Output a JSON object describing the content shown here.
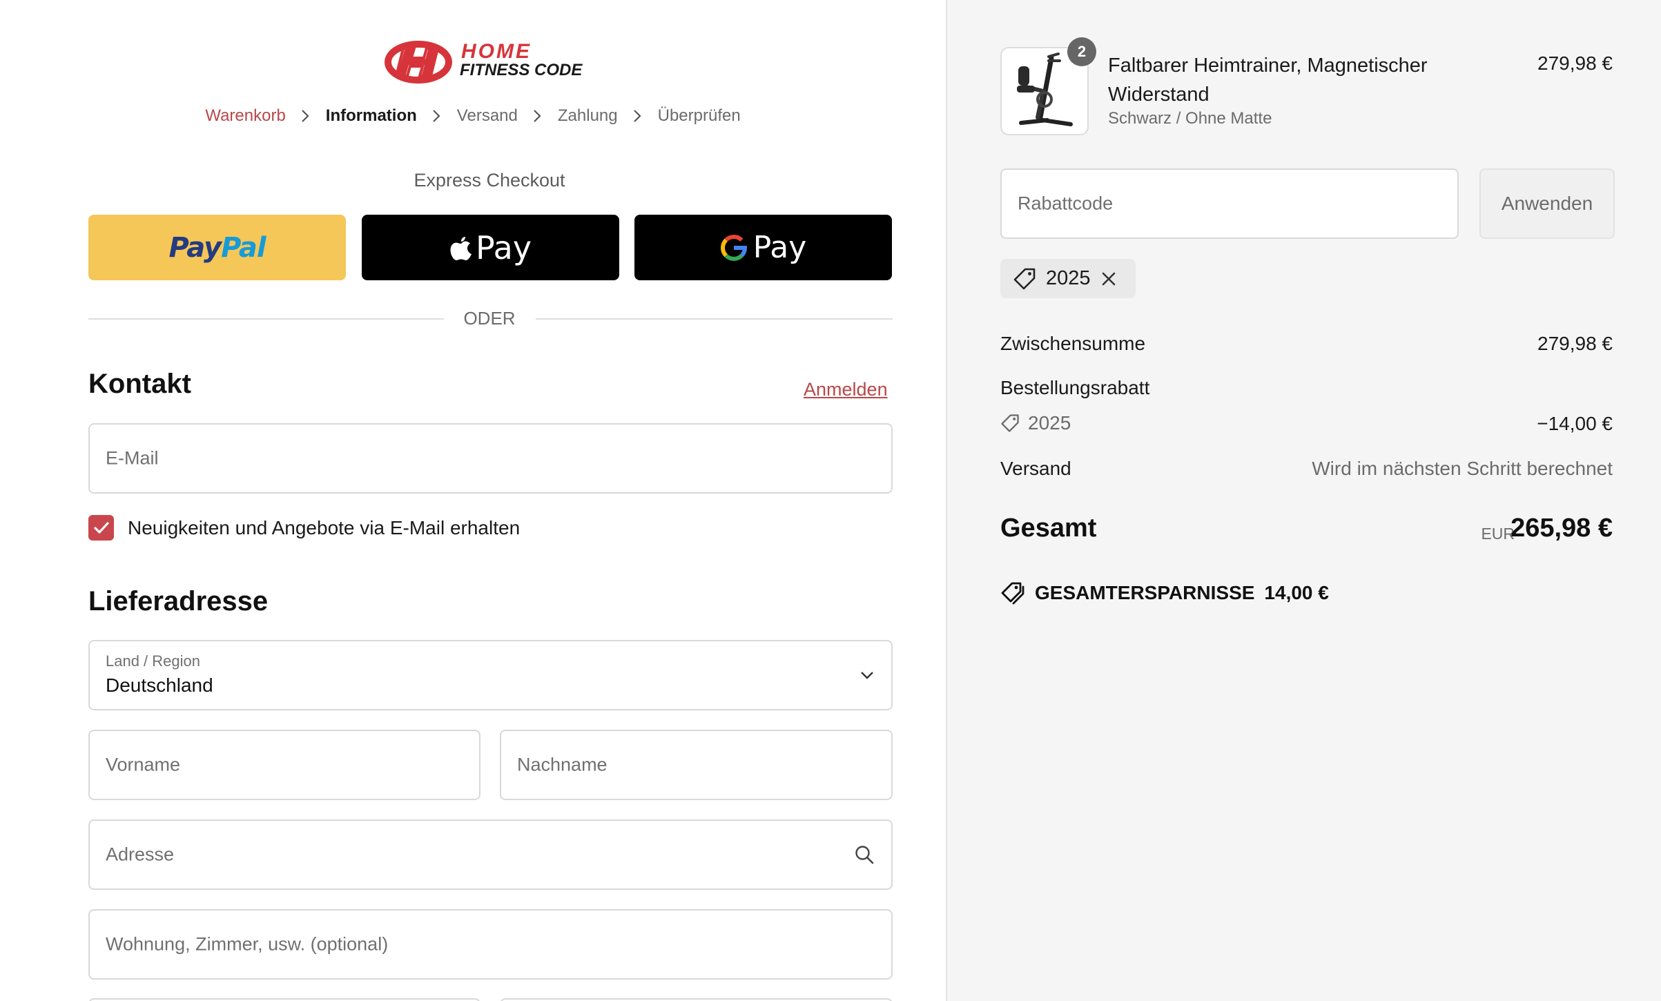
{
  "brand": {
    "line1": "HOME",
    "line2": "FITNESS CODE"
  },
  "breadcrumb": [
    {
      "label": "Warenkorb",
      "state": "link"
    },
    {
      "label": "Information",
      "state": "active"
    },
    {
      "label": "Versand",
      "state": "inactive"
    },
    {
      "label": "Zahlung",
      "state": "inactive"
    },
    {
      "label": "Überprüfen",
      "state": "inactive"
    }
  ],
  "express": {
    "label": "Express Checkout",
    "paypal_a": "Pay",
    "paypal_b": "Pal",
    "apple_pay": "Pay",
    "google_pay": "Pay",
    "divider": "ODER"
  },
  "contact": {
    "title": "Kontakt",
    "login": "Anmelden",
    "email_placeholder": "E-Mail",
    "newsletter_label": "Neuigkeiten und Angebote via E-Mail erhalten",
    "newsletter_checked": true
  },
  "delivery": {
    "title": "Lieferadresse",
    "country_label": "Land / Region",
    "country_value": "Deutschland",
    "first_name_placeholder": "Vorname",
    "last_name_placeholder": "Nachname",
    "address_placeholder": "Adresse",
    "apartment_placeholder": "Wohnung, Zimmer, usw. (optional)"
  },
  "summary": {
    "product": {
      "name": "Faltbarer Heimtrainer, Magnetischer Widerstand",
      "variant": "Schwarz / Ohne Matte",
      "price": "279,98 €",
      "quantity": "2"
    },
    "discount_placeholder": "Rabattcode",
    "apply_label": "Anwenden",
    "applied_code": "2025",
    "subtotal_label": "Zwischensumme",
    "subtotal_value": "279,98 €",
    "order_discount_label": "Bestellungsrabatt",
    "order_discount_code": "2025",
    "order_discount_value": "−14,00 €",
    "shipping_label": "Versand",
    "shipping_value": "Wird im nächsten Schritt berechnet",
    "total_label": "Gesamt",
    "total_currency": "EUR",
    "total_value": "265,98 €",
    "savings_label": "GESAMTERSPARNISSE",
    "savings_value": "14,00 €"
  },
  "colors": {
    "accent": "#c9474c",
    "paypal_yellow": "#f4c758",
    "summary_bg": "#f5f5f5"
  }
}
